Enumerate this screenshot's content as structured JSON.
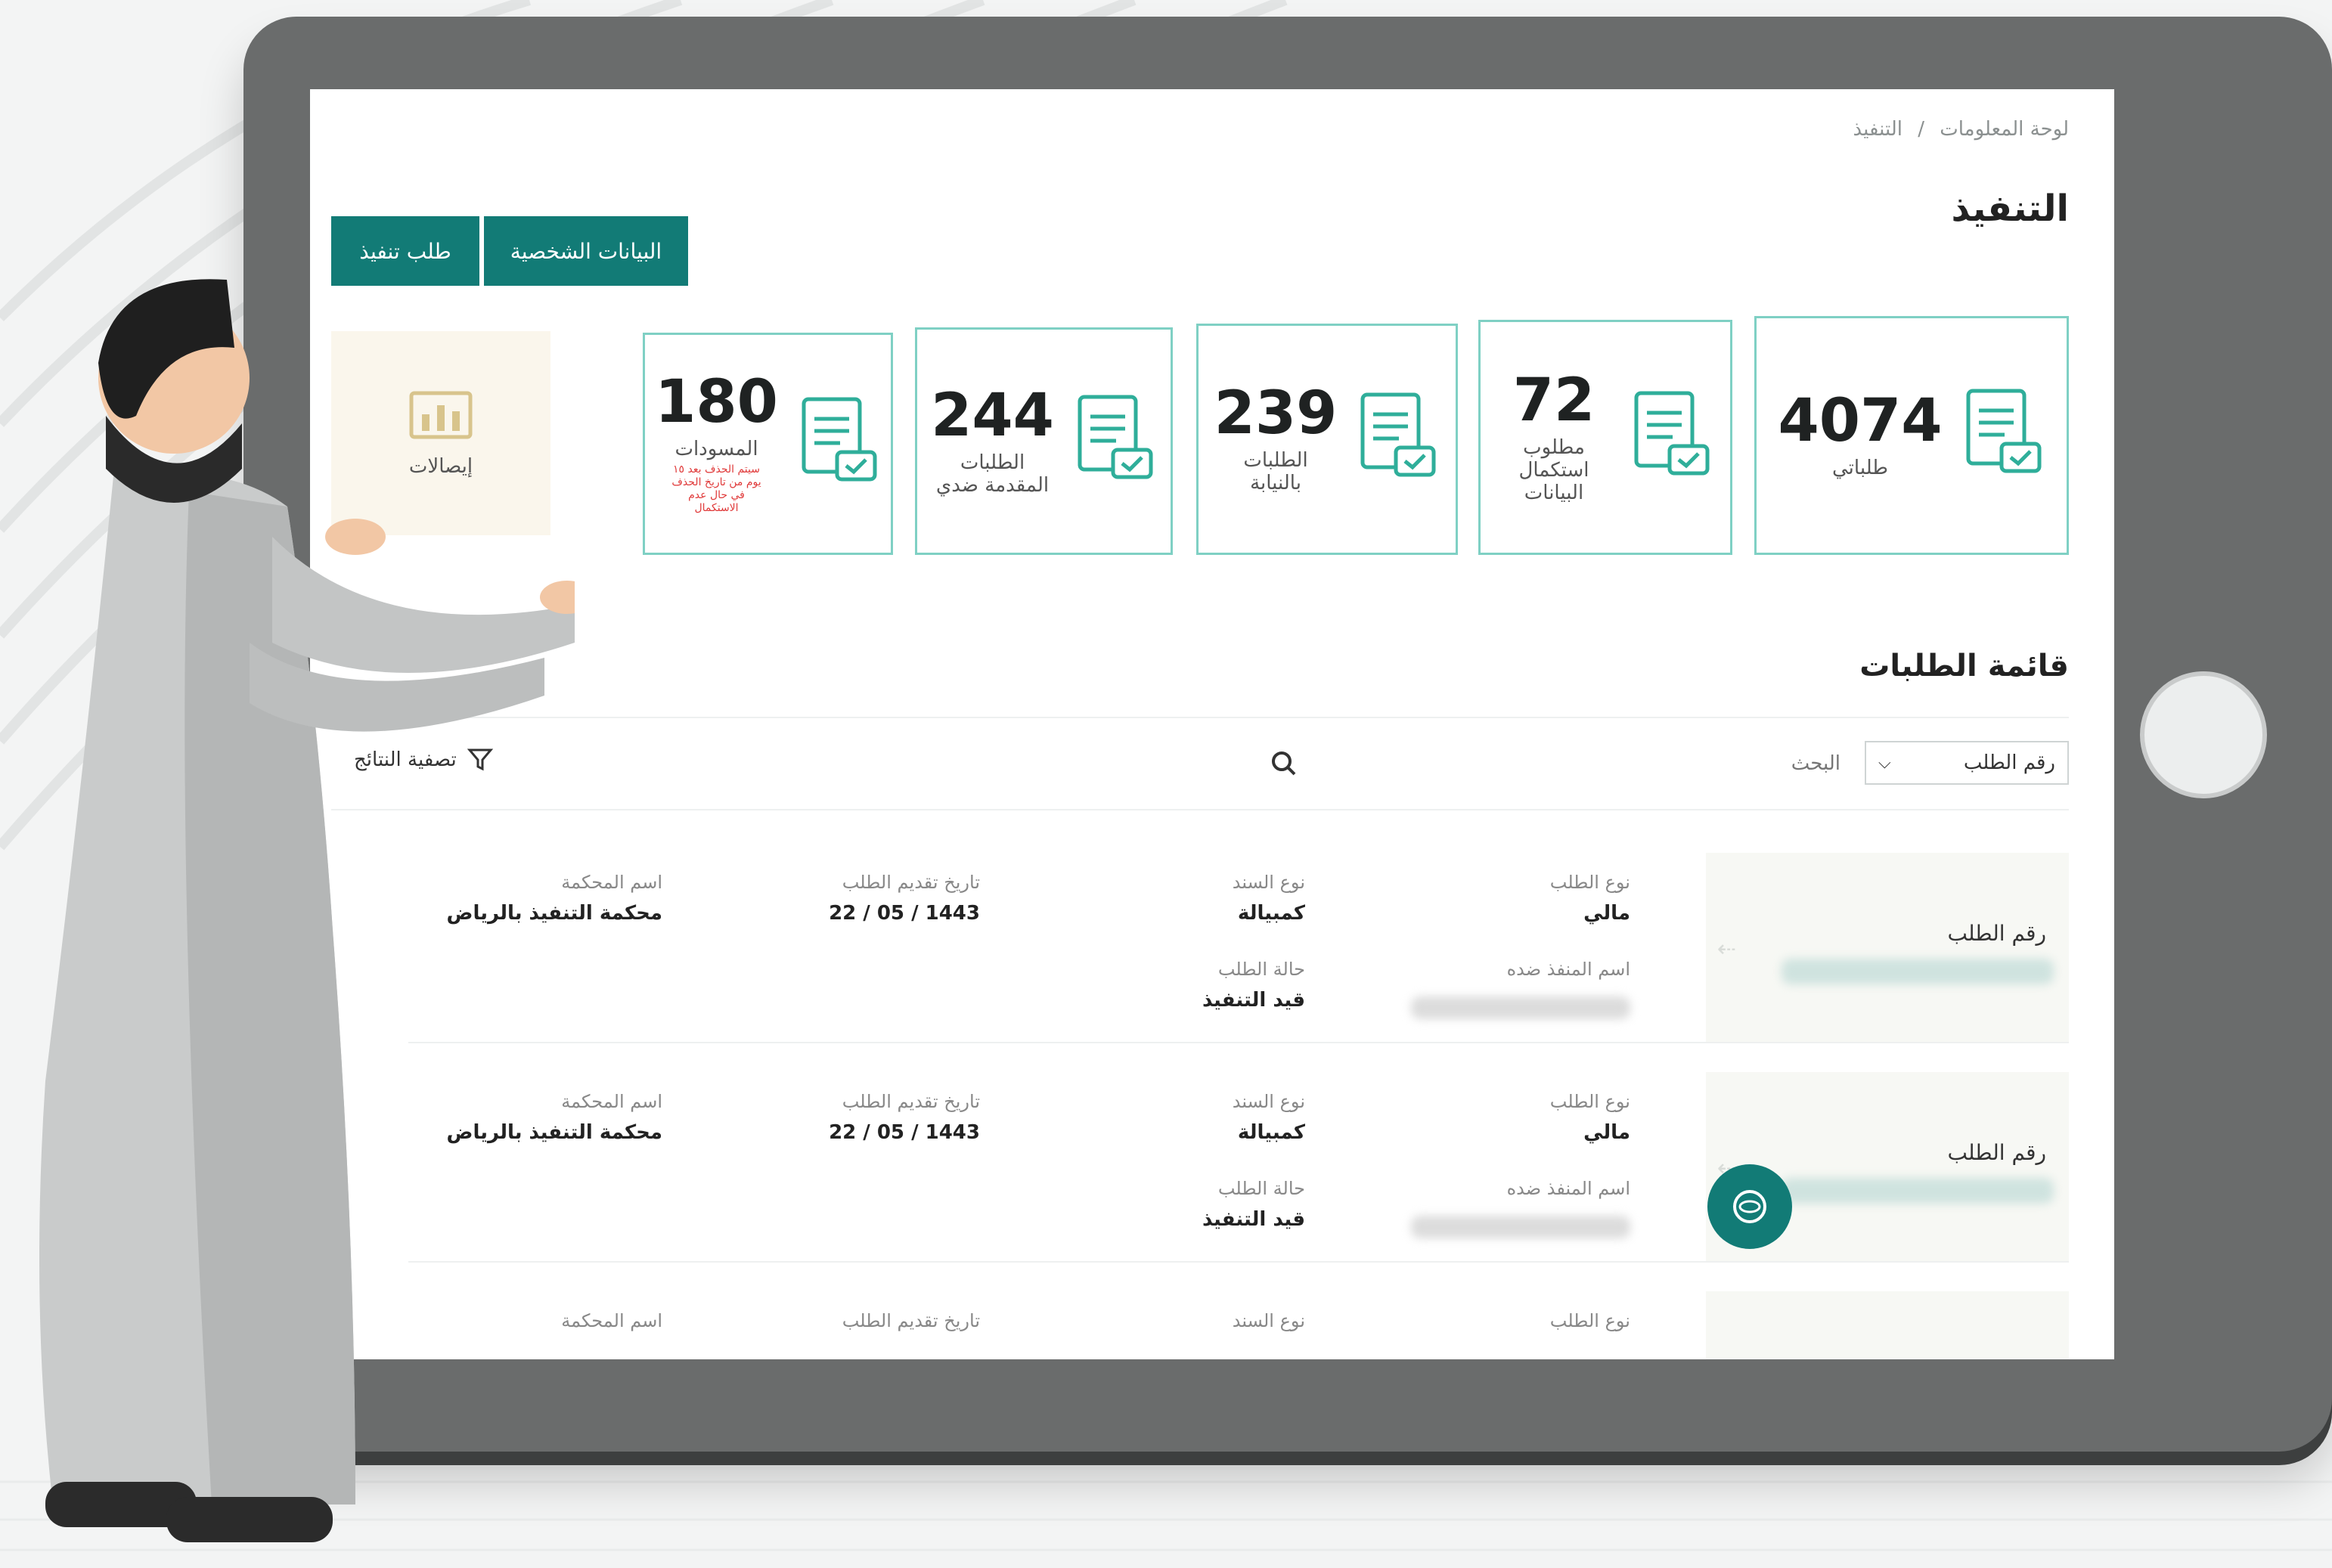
{
  "breadcrumb": {
    "home": "لوحة المعلومات",
    "sep": "/",
    "current": "التنفيذ"
  },
  "page_title": "التنفيذ",
  "buttons": {
    "personal_data": "البيانات الشخصية",
    "execution_request": "طلب تنفيذ"
  },
  "stats": [
    {
      "number": "4074",
      "label": "طلباتي"
    },
    {
      "number": "72",
      "label": "مطلوب استكمال البيانات"
    },
    {
      "number": "239",
      "label": "الطلبات بالنيابة"
    },
    {
      "number": "244",
      "label": "الطلبات المقدمة ضدي"
    },
    {
      "number": "180",
      "label": "المسودات",
      "note": "سيتم الحذف بعد ١٥ يوم من تاريخ الحذف في حال عدم الاستكمال"
    }
  ],
  "receipts_label": "إيصالات",
  "list_title": "قائمة الطلبات",
  "search": {
    "select_value": "رقم الطلب",
    "placeholder": "البحث",
    "filter_label": "تصفية النتائج"
  },
  "row_labels": {
    "request_number": "رقم الطلب",
    "request_type": "نوع الطلب",
    "bond_type": "نوع السند",
    "submit_date": "تاريخ تقديم الطلب",
    "court_name": "اسم المحكمة",
    "defendant_name": "اسم المنفذ ضده",
    "request_status": "حالة الطلب"
  },
  "rows": [
    {
      "request_type": "مالي",
      "bond_type": "كمبيالة",
      "submit_date": "22 / 05 / 1443",
      "court_name": "محكمة التنفيذ بالرياض",
      "request_status": "قيد التنفيذ"
    },
    {
      "request_type": "مالي",
      "bond_type": "كمبيالة",
      "submit_date": "22 / 05 / 1443",
      "court_name": "محكمة التنفيذ بالرياض",
      "request_status": "قيد التنفيذ"
    }
  ],
  "colors": {
    "primary": "#127b76",
    "card_border": "#7fd0c4",
    "receipts_bg": "#faf6ec",
    "tablet": "#6a6c6c"
  }
}
